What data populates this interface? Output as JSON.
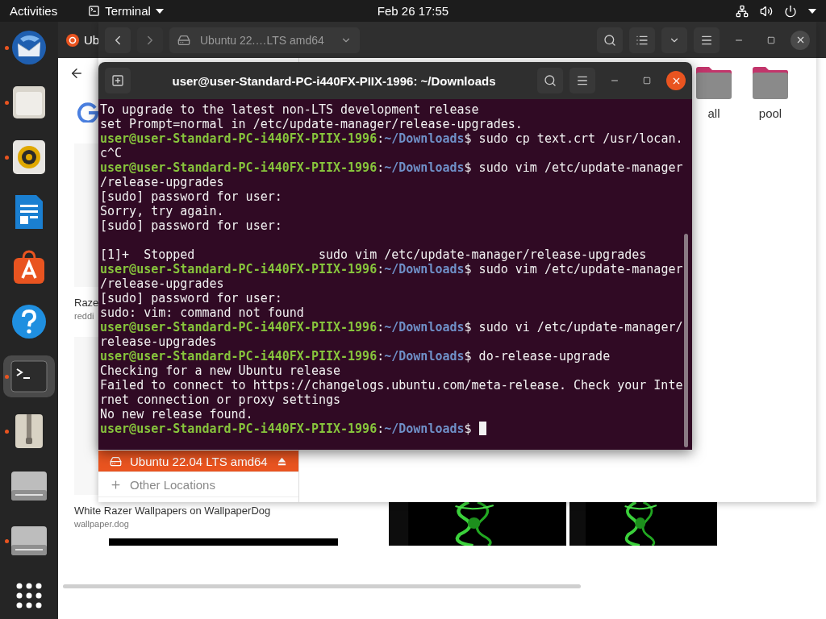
{
  "top_bar": {
    "activities": "Activities",
    "app_menu": "Terminal",
    "clock": "Feb 26  17:55"
  },
  "dock": [
    {
      "kind": "mail",
      "running": true,
      "selected": false
    },
    {
      "kind": "files",
      "running": true,
      "selected": false
    },
    {
      "kind": "music",
      "running": true,
      "selected": false
    },
    {
      "kind": "writer",
      "running": false,
      "selected": false
    },
    {
      "kind": "store",
      "running": false,
      "selected": false
    },
    {
      "kind": "help",
      "running": false,
      "selected": false
    },
    {
      "kind": "terminal",
      "running": true,
      "selected": true
    },
    {
      "kind": "archive",
      "running": true,
      "selected": false
    },
    {
      "kind": "drive",
      "running": false,
      "selected": false
    },
    {
      "kind": "drive",
      "running": true,
      "selected": false
    },
    {
      "kind": "grid",
      "running": false,
      "selected": false
    }
  ],
  "browser": {
    "tab": "Ub",
    "results": [
      {
        "title": "Raze",
        "source": "reddi"
      },
      {
        "title": "White Razer Wallpapers on WallpaperDog",
        "source": "wallpaper.dog"
      }
    ]
  },
  "file_manager": {
    "path": "Ubuntu 22.…LTS amd64",
    "folders": [
      {
        "label": "all"
      },
      {
        "label": "pool"
      }
    ],
    "sidebar": [
      {
        "kind": "drive",
        "label": "Ubuntu 22.04 LTS amd64",
        "selected": true
      },
      {
        "kind": "add",
        "label": "Other Locations",
        "selected": false
      }
    ]
  },
  "terminal": {
    "title": "user@user-Standard-PC-i440FX-PIIX-1996: ~/Downloads",
    "lines": [
      {
        "kind": "output",
        "text": "To upgrade to the latest non-LTS development release"
      },
      {
        "kind": "output",
        "text": "set Prompt=normal in /etc/update-manager/release-upgrades."
      },
      {
        "kind": "prompt",
        "user": "user@user-Standard-PC-i440FX-PIIX-1996",
        "sep": ":",
        "path": "~/Downloads",
        "command": "$ sudo cp text.crt /usr/locan.",
        "cursor": false
      },
      {
        "kind": "output",
        "text": "c^C"
      },
      {
        "kind": "prompt",
        "user": "user@user-Standard-PC-i440FX-PIIX-1996",
        "sep": ":",
        "path": "~/Downloads",
        "command": "$ sudo vim /etc/update-manager",
        "cursor": false
      },
      {
        "kind": "output",
        "text": "/release-upgrades"
      },
      {
        "kind": "output",
        "text": "[sudo] password for user:"
      },
      {
        "kind": "output",
        "text": "Sorry, try again."
      },
      {
        "kind": "output",
        "text": "[sudo] password for user:"
      },
      {
        "kind": "blank"
      },
      {
        "kind": "output",
        "text": "[1]+  Stopped                 sudo vim /etc/update-manager/release-upgrades"
      },
      {
        "kind": "prompt",
        "user": "user@user-Standard-PC-i440FX-PIIX-1996",
        "sep": ":",
        "path": "~/Downloads",
        "command": "$ sudo vim /etc/update-manager",
        "cursor": false
      },
      {
        "kind": "output",
        "text": "/release-upgrades"
      },
      {
        "kind": "output",
        "text": "[sudo] password for user:"
      },
      {
        "kind": "output",
        "text": "sudo: vim: command not found"
      },
      {
        "kind": "prompt",
        "user": "user@user-Standard-PC-i440FX-PIIX-1996",
        "sep": ":",
        "path": "~/Downloads",
        "command": "$ sudo vi /etc/update-manager/",
        "cursor": false
      },
      {
        "kind": "output",
        "text": "release-upgrades"
      },
      {
        "kind": "prompt",
        "user": "user@user-Standard-PC-i440FX-PIIX-1996",
        "sep": ":",
        "path": "~/Downloads",
        "command": "$ do-release-upgrade",
        "cursor": false
      },
      {
        "kind": "output",
        "text": "Checking for a new Ubuntu release"
      },
      {
        "kind": "output",
        "text": "Failed to connect to https://changelogs.ubuntu.com/meta-release. Check your Inte"
      },
      {
        "kind": "output",
        "text": "rnet connection or proxy settings"
      },
      {
        "kind": "output",
        "text": "No new release found."
      },
      {
        "kind": "prompt",
        "user": "user@user-Standard-PC-i440FX-PIIX-1996",
        "sep": ":",
        "path": "~/Downloads",
        "command": "$ ",
        "cursor": true
      }
    ]
  }
}
